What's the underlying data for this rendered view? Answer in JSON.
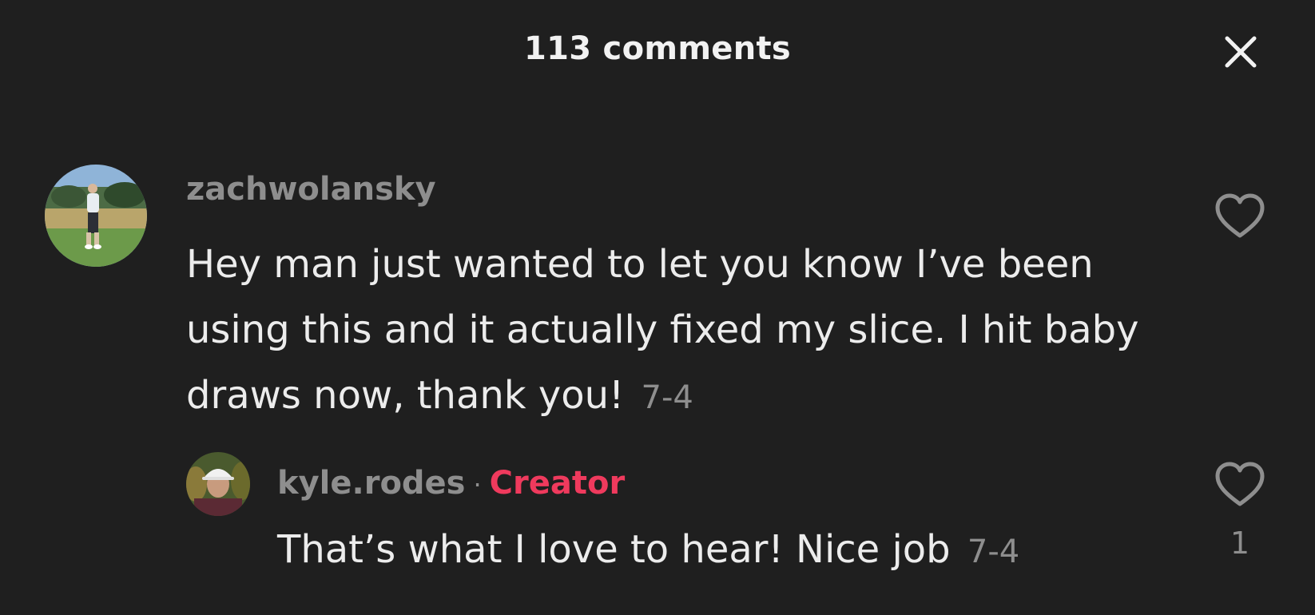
{
  "header": {
    "title": "113 comments",
    "close_icon": "close-icon"
  },
  "comment": {
    "username": "zachwolansky",
    "text": "Hey man just wanted to let you know I’ve been using this and it actually fixed my slice. I hit baby draws now, thank you!",
    "timestamp": "7-4",
    "avatar": "golfer-avatar",
    "like_icon": "heart-outline-icon"
  },
  "reply": {
    "username": "kyle.rodes",
    "separator": "·",
    "badge": "Creator",
    "text": "That’s what I love to hear! Nice job",
    "timestamp": "7-4",
    "avatar": "creator-avatar",
    "like_icon": "heart-outline-icon",
    "like_count": "1"
  },
  "colors": {
    "background": "#1f1f1f",
    "primary_text": "#ececec",
    "secondary_text": "#8e8e8e",
    "creator_accent": "#ef3a5d"
  }
}
